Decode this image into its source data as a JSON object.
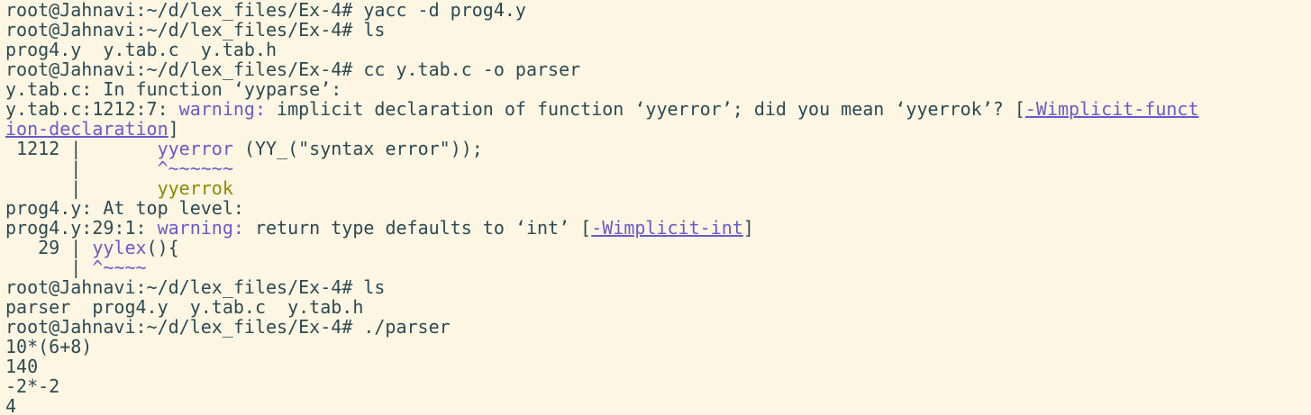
{
  "terminal": {
    "lines": {
      "l1": "root@Jahnavi:~/d/lex_files/Ex-4# yacc -d prog4.y",
      "l2": "root@Jahnavi:~/d/lex_files/Ex-4# ls",
      "l3": "prog4.y  y.tab.c  y.tab.h",
      "l4": "root@Jahnavi:~/d/lex_files/Ex-4# cc y.tab.c -o parser",
      "l5": "y.tab.c: In function ‘yyparse’:",
      "l6_prefix": "y.tab.c:1212:7: ",
      "l6_warning": "warning:",
      "l6_text": " implicit declaration of function ‘yyerror’; did you mean ‘yyerrok’? [",
      "l6_flag": "-Wimplicit-funct",
      "l7_flag": "ion-declaration",
      "l7_end": "]",
      "l8_gutter": " 1212 |       ",
      "l8_fn": "yyerror",
      "l8_rest": " (YY_(\"syntax error\"));",
      "l9_gutter": "      |       ",
      "l9_caret": "^~~~~~~",
      "l10_gutter": "      |       ",
      "l10_sugg": "yyerrok",
      "l11": "prog4.y: At top level:",
      "l12_prefix": "prog4.y:29:1: ",
      "l12_warning": "warning:",
      "l12_text": " return type defaults to ‘int’ [",
      "l12_flag": "-Wimplicit-int",
      "l12_end": "]",
      "l13_gutter": "   29 | ",
      "l13_fn": "yylex",
      "l13_rest": "(){",
      "l14_gutter": "      | ",
      "l14_caret": "^~~~~",
      "l15": "root@Jahnavi:~/d/lex_files/Ex-4# ls",
      "l16": "parser  prog4.y  y.tab.c  y.tab.h",
      "l17": "root@Jahnavi:~/d/lex_files/Ex-4# ./parser",
      "l18": "10*(6+8)",
      "l19": "140",
      "l20": "-2*-2",
      "l21": "4"
    }
  }
}
